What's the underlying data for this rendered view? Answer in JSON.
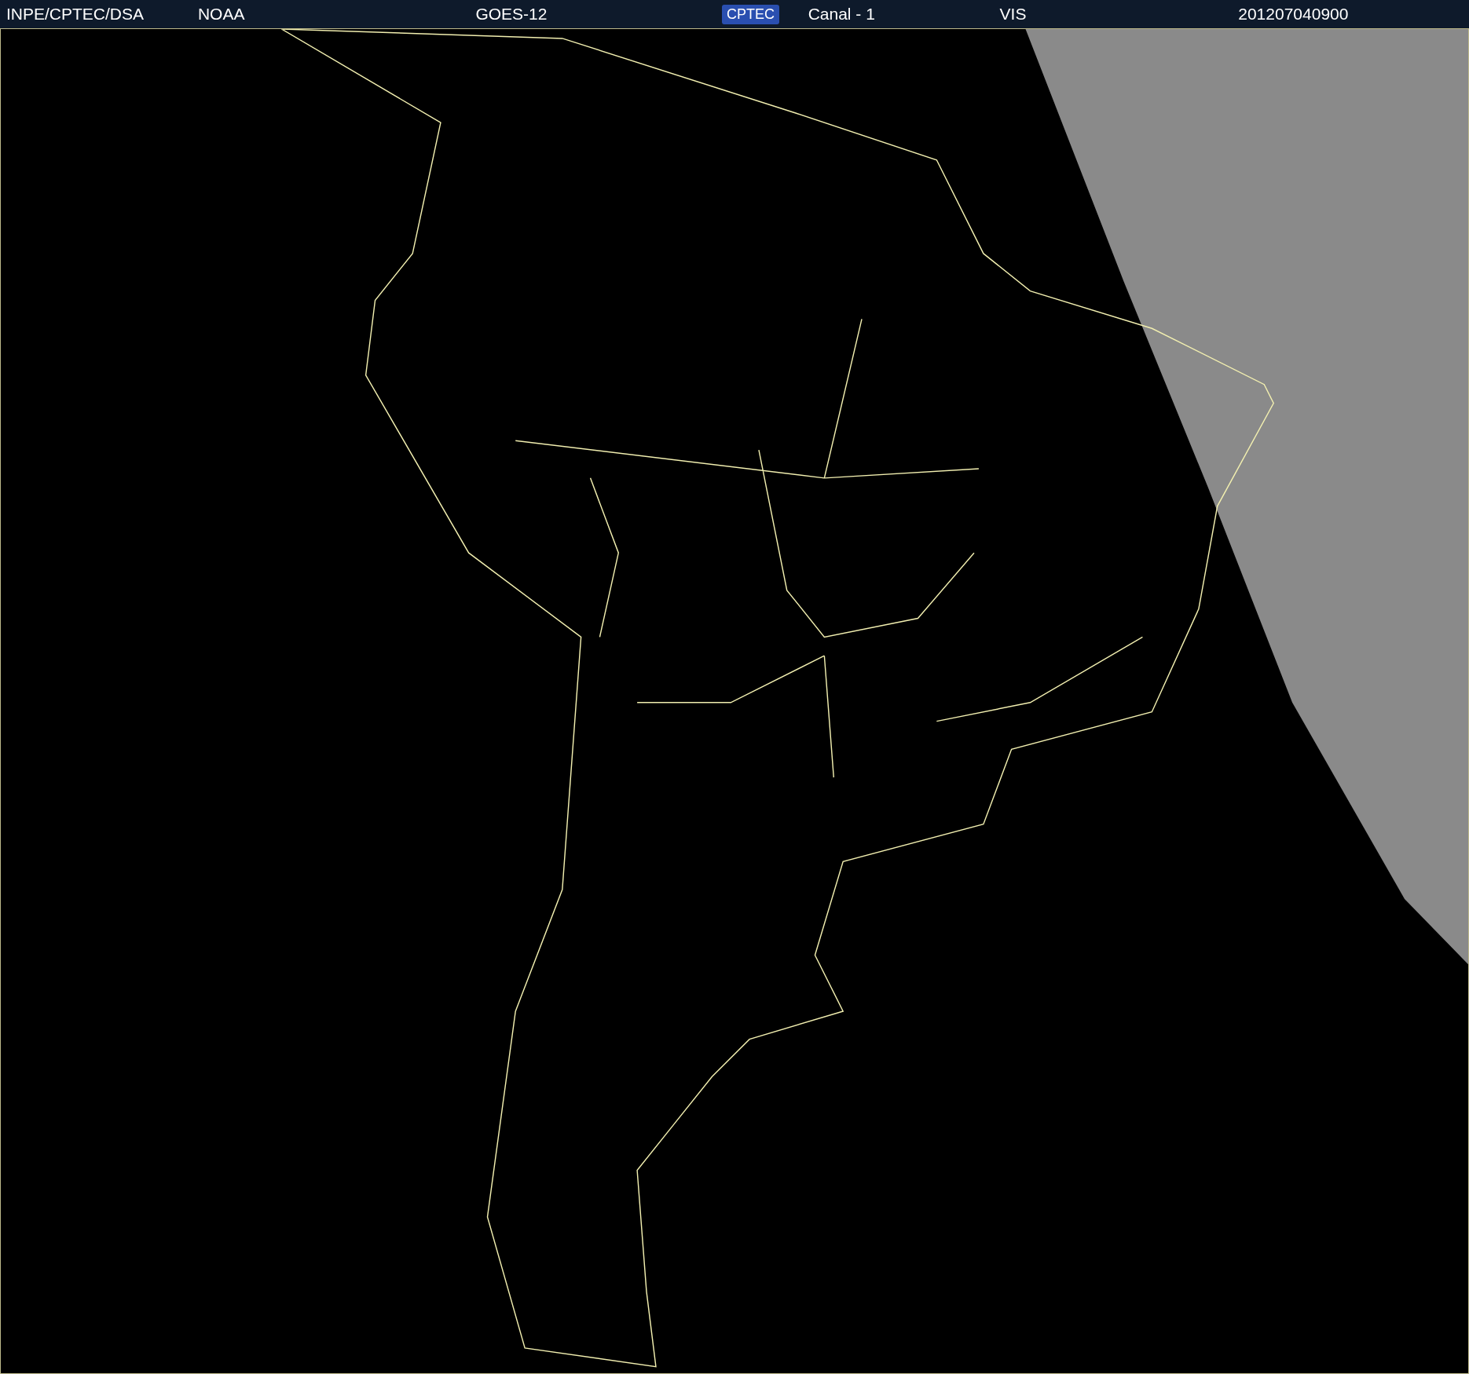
{
  "header": {
    "items": [
      {
        "kind": "text",
        "text": "INPE/CPTEC/DSA"
      },
      {
        "kind": "text",
        "text": "NOAA"
      },
      {
        "kind": "text",
        "text": "GOES-12"
      },
      {
        "kind": "logo",
        "text": "CPTEC"
      },
      {
        "kind": "text",
        "text": "Canal - 1"
      },
      {
        "kind": "text",
        "text": "VIS"
      },
      {
        "kind": "text",
        "text": "201207040900"
      }
    ]
  }
}
